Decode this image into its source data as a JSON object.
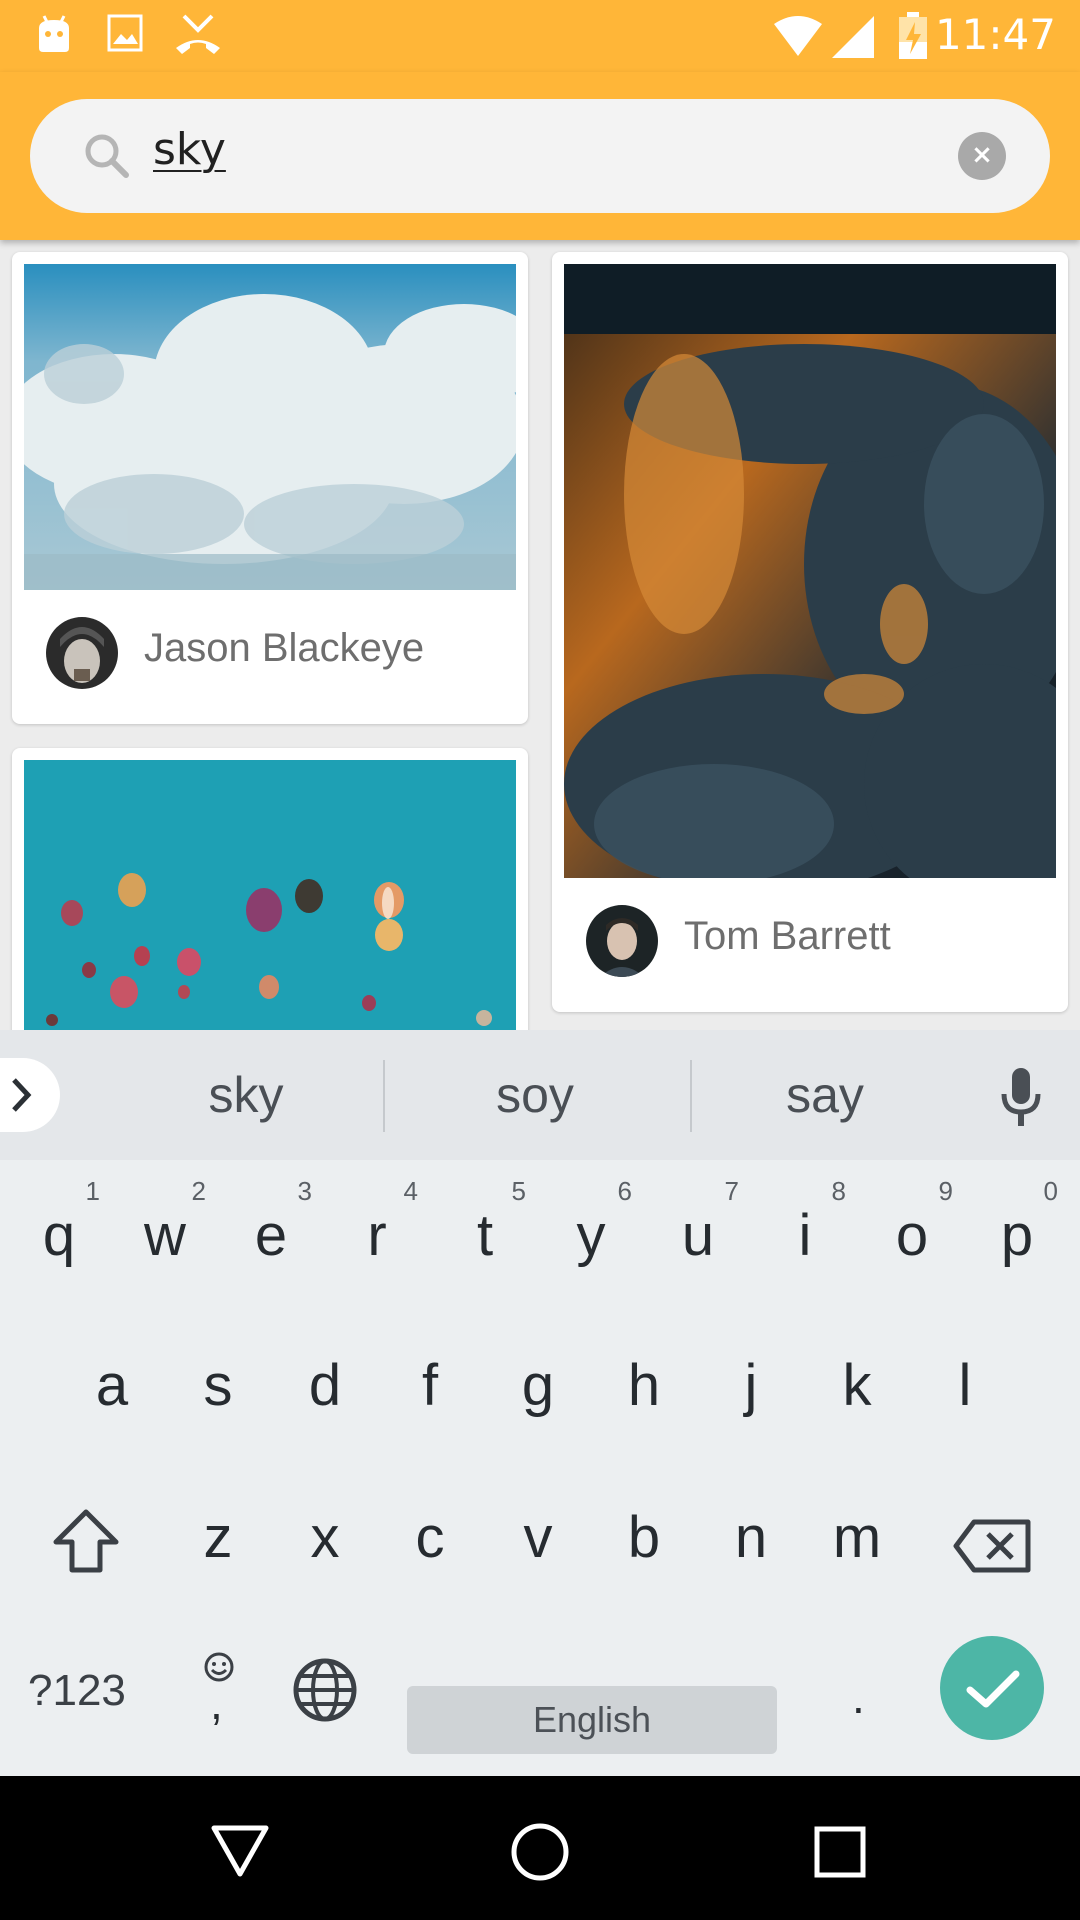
{
  "status_bar": {
    "time": "11:47",
    "left_icons": [
      "android-debug-icon",
      "image-icon",
      "missed-call-icon"
    ],
    "right_icons": [
      "wifi-icon",
      "signal-icon",
      "battery-charging-icon"
    ],
    "background": "#ffb638"
  },
  "search": {
    "query": "sky",
    "clear_label": "×"
  },
  "results": [
    {
      "user": "Jason Blackeye",
      "image": "cumulus-clouds-photo"
    },
    {
      "user": "Tom Barrett",
      "image": "sunlit-storm-clouds-photo"
    },
    {
      "user": "",
      "image": "hot-air-balloons-photo"
    }
  ],
  "keyboard": {
    "suggestions": [
      "sky",
      "soy",
      "say"
    ],
    "row1": [
      {
        "key": "q",
        "hint": "1"
      },
      {
        "key": "w",
        "hint": "2"
      },
      {
        "key": "e",
        "hint": "3"
      },
      {
        "key": "r",
        "hint": "4"
      },
      {
        "key": "t",
        "hint": "5"
      },
      {
        "key": "y",
        "hint": "6"
      },
      {
        "key": "u",
        "hint": "7"
      },
      {
        "key": "i",
        "hint": "8"
      },
      {
        "key": "o",
        "hint": "9"
      },
      {
        "key": "p",
        "hint": "0"
      }
    ],
    "row2": [
      "a",
      "s",
      "d",
      "f",
      "g",
      "h",
      "j",
      "k",
      "l"
    ],
    "row3": [
      "z",
      "x",
      "c",
      "v",
      "b",
      "n",
      "m"
    ],
    "symbols_label": "?123",
    "comma_label": ",",
    "space_label": "English",
    "period_label": ".",
    "enter_color": "#4db6a6"
  },
  "nav_bar": {
    "buttons": [
      "back-icon",
      "home-icon",
      "recents-icon"
    ]
  }
}
